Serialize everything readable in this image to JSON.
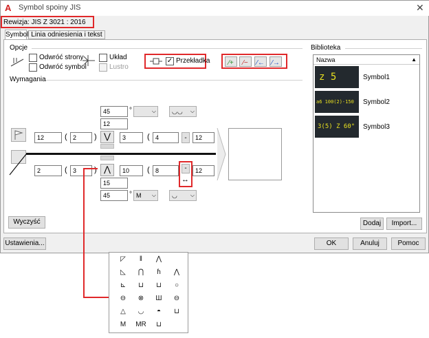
{
  "window": {
    "title": "Symbol spoiny JIS",
    "revision": "Rewizja: JIS Z 3021 : 2016"
  },
  "tabs": [
    {
      "label": "Symbol"
    },
    {
      "label": "Linia odniesienia i tekst"
    }
  ],
  "options": {
    "section_label": "Opcje",
    "flip_side": "Odwróć strony",
    "flip_symbol": "Odwróć symbol",
    "layout": "Układ",
    "mirror": "Lustro",
    "spacer": "Przekładka"
  },
  "requirements": {
    "section_label": "Wymagania",
    "top_angle": "45",
    "top_angle_unit": "°",
    "top_depth": "12",
    "top_size": "12",
    "top_groove": "2",
    "top_root": "3",
    "top_count": "4",
    "top_dash": "-",
    "top_pitch": "12",
    "bottom_size": "2",
    "bottom_groove": "3",
    "bottom_root": "10",
    "bottom_count": "8",
    "bottom_dash": "-",
    "bottom_pitch": "12",
    "bottom_depth": "15",
    "bottom_angle": "45",
    "bottom_angle_unit": "°",
    "bottom_finish": "M"
  },
  "library": {
    "section_label": "Biblioteka",
    "column_header": "Nazwa",
    "items": [
      {
        "name": "Symbol1",
        "thumb": "z 5"
      },
      {
        "name": "Symbol2",
        "thumb": "a6 100(2)-150"
      },
      {
        "name": "Symbol3",
        "thumb": "3(5) Z 60°"
      }
    ]
  },
  "buttons": {
    "clear": "Wyczyść",
    "add": "Dodaj",
    "import": "Import...",
    "settings": "Ustawienia...",
    "ok": "OK",
    "cancel": "Anuluj",
    "help": "Pomoc"
  },
  "palette": {
    "rows": [
      [
        "◸",
        "‖",
        "⋀",
        ""
      ],
      [
        "◺",
        "⋂",
        "ɦ",
        "⋀"
      ],
      [
        "⊾",
        "⊔",
        "⊔",
        "○"
      ],
      [
        "⊖",
        "⊗",
        "Ш",
        "⊖"
      ],
      [
        "△",
        "◡",
        "◓",
        "⊔"
      ],
      [
        "M",
        "MR",
        "⊔",
        ""
      ]
    ]
  },
  "colors": {
    "highlight": "#e0282a",
    "thumb_bg": "#23292e",
    "thumb_fg": "#e8e020"
  }
}
